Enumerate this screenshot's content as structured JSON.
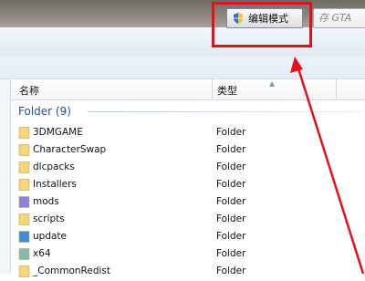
{
  "toolbar": {
    "compat_button_label": "编辑模式",
    "gta_button_label": "存 GTA"
  },
  "columns": {
    "name": "名称",
    "type": "类型"
  },
  "group": {
    "label": "Folder (9)"
  },
  "files": [
    {
      "name": "3DMGAME",
      "type": "Folder",
      "icon": "folder-icon",
      "color": "#f3d57a"
    },
    {
      "name": "CharacterSwap",
      "type": "Folder",
      "icon": "folder-icon",
      "color": "#f3d57a"
    },
    {
      "name": "dlcpacks",
      "type": "Folder",
      "icon": "folder-icon",
      "color": "#f3d57a"
    },
    {
      "name": "Installers",
      "type": "Folder",
      "icon": "folder-icon",
      "color": "#f3d57a"
    },
    {
      "name": "mods",
      "type": "Folder",
      "icon": "folder-icon",
      "color": "#8f7fd6"
    },
    {
      "name": "scripts",
      "type": "Folder",
      "icon": "folder-icon",
      "color": "#f3d57a"
    },
    {
      "name": "update",
      "type": "Folder",
      "icon": "folder-icon",
      "color": "#3f8fd8"
    },
    {
      "name": "x64",
      "type": "Folder",
      "icon": "folder-icon",
      "color": "#7fbdb0"
    },
    {
      "name": "_CommonRedist",
      "type": "Folder",
      "icon": "folder-icon",
      "color": "#f3d57a"
    }
  ],
  "colors": {
    "highlight_red": "#e4101a",
    "group_blue": "#1e4f9c"
  }
}
